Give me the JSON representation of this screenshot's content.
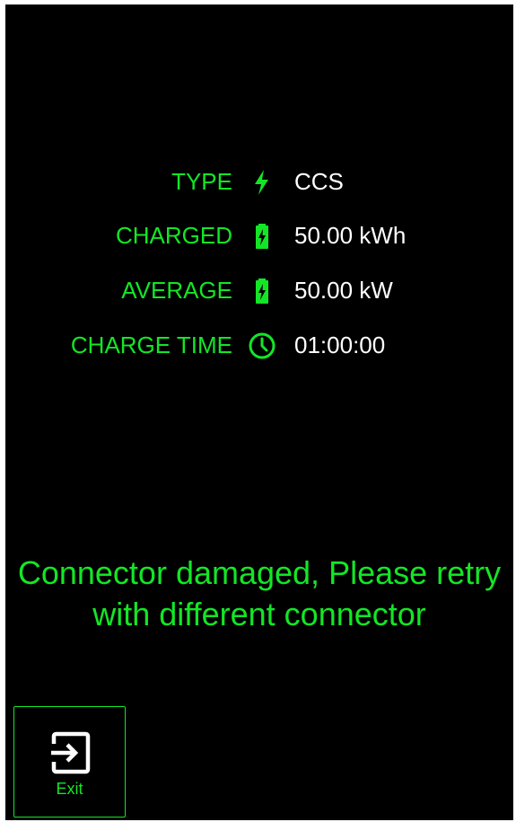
{
  "colors": {
    "accent": "#13e626",
    "background": "#000000",
    "value_text": "#ffffff"
  },
  "session": {
    "rows": [
      {
        "label": "TYPE",
        "icon": "lightning-bolt-icon",
        "value": "CCS"
      },
      {
        "label": "CHARGED",
        "icon": "battery-charging-icon",
        "value": "50.00 kWh"
      },
      {
        "label": "AVERAGE",
        "icon": "battery-charging-icon",
        "value": "50.00 kW"
      },
      {
        "label": "CHARGE TIME",
        "icon": "clock-icon",
        "value": "01:00:00"
      }
    ]
  },
  "status": {
    "message": "Connector damaged, Please retry with different connector"
  },
  "exit_button": {
    "icon": "exit-icon",
    "label": "Exit"
  }
}
